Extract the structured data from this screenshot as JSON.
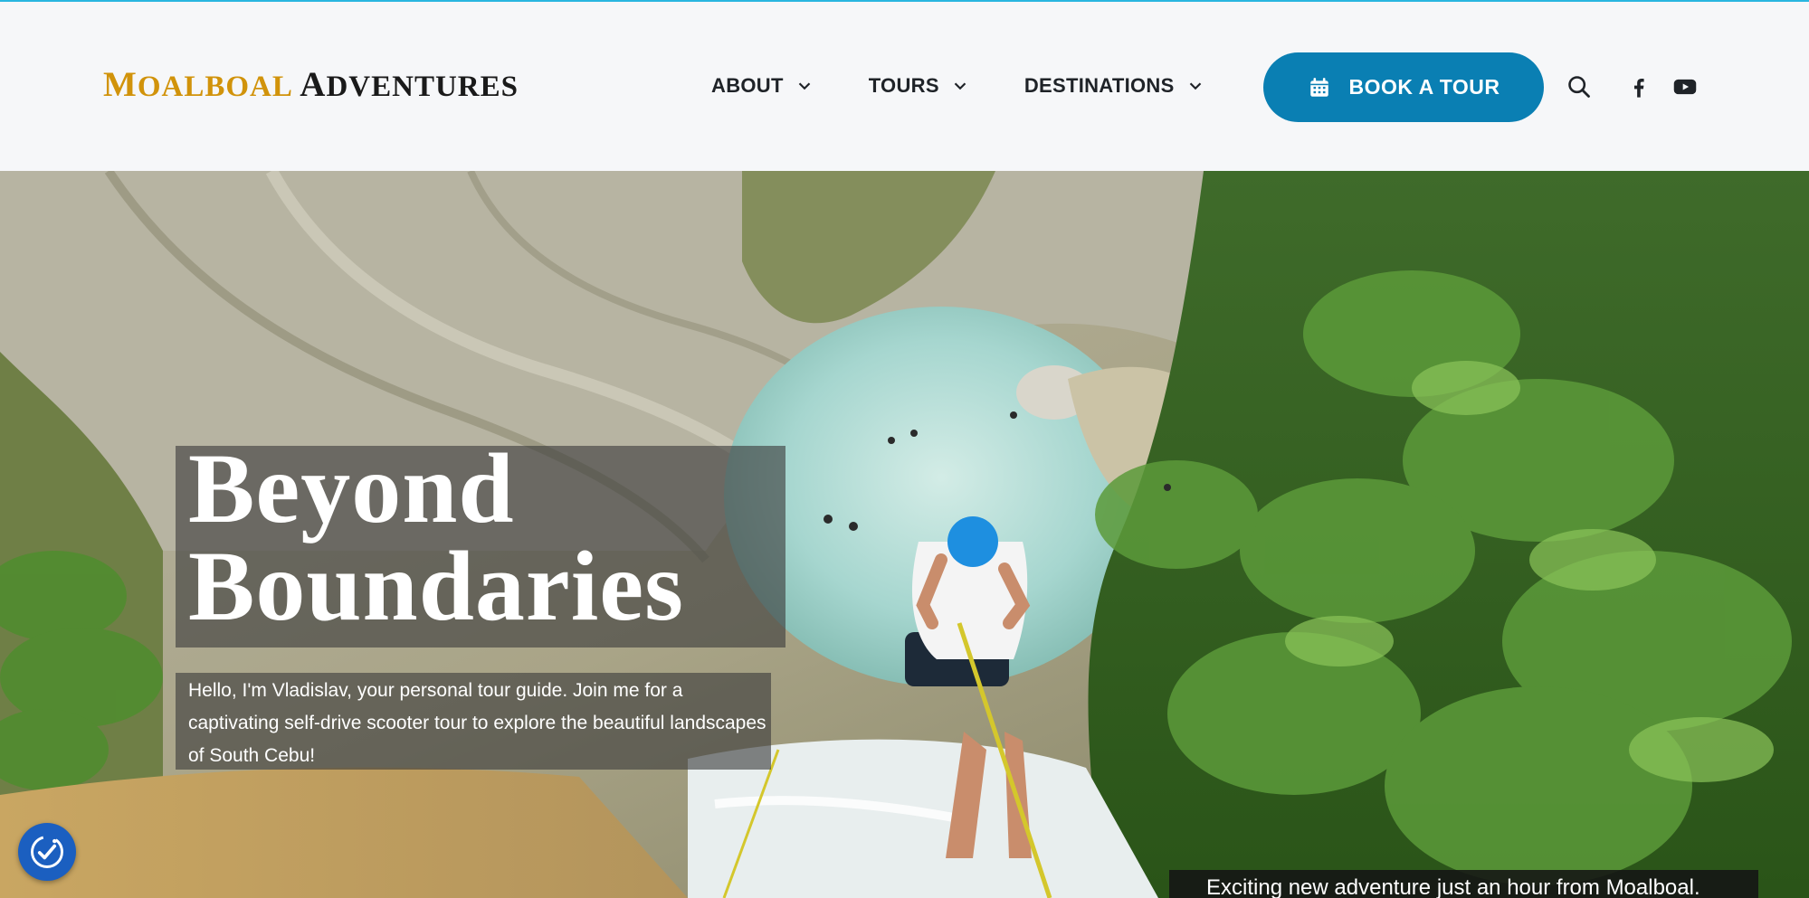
{
  "brand": {
    "logo_text_1": "Moalboal",
    "logo_text_2": "Adventures"
  },
  "nav": {
    "items": [
      {
        "label": "ABOUT"
      },
      {
        "label": "TOURS"
      },
      {
        "label": "DESTINATIONS"
      }
    ],
    "book_label": "BOOK A TOUR"
  },
  "icons": {
    "search": "search-icon",
    "facebook": "facebook-icon",
    "youtube": "youtube-icon",
    "calendar": "calendar-icon",
    "accessibility": "accessibility-icon"
  },
  "hero": {
    "headline_line1": "Beyond",
    "headline_line2": "Boundaries",
    "intro": "Hello, I'm Vladislav, your personal tour guide. Join me for a captivating self-drive scooter tour to explore the beautiful landscapes of South Cebu!",
    "caption": "Exciting new adventure just an hour from Moalboal."
  },
  "colors": {
    "accent": "#0a7fb3",
    "logo_gold": "#d1930b",
    "top_line": "#29b6e0"
  }
}
